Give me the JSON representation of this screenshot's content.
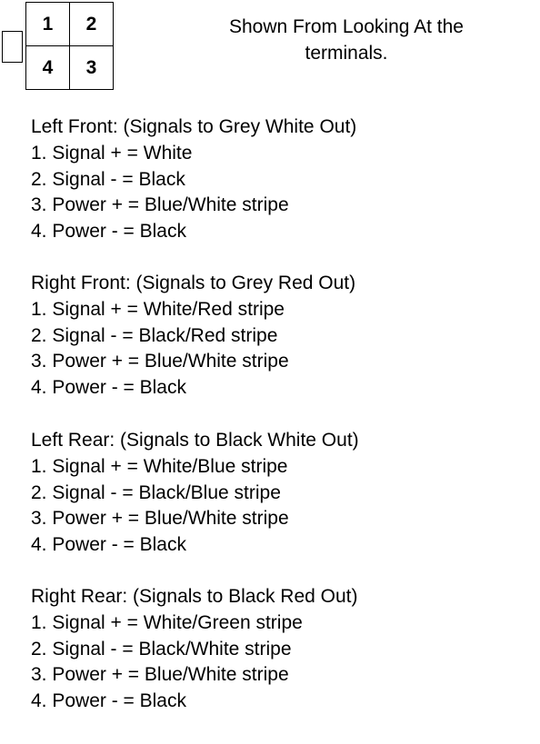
{
  "connector": {
    "pins": [
      {
        "position": "top-left",
        "label": "1"
      },
      {
        "position": "top-right",
        "label": "2"
      },
      {
        "position": "bottom-left",
        "label": "4"
      },
      {
        "position": "bottom-right",
        "label": "3"
      }
    ]
  },
  "caption": {
    "line1": "Shown From Looking At the",
    "line2": "terminals."
  },
  "sections": [
    {
      "title": "Left Front: (Signals to Grey White Out)",
      "lines": [
        "1. Signal + = White",
        "2. Signal - = Black",
        "3. Power + = Blue/White stripe",
        "4. Power - = Black"
      ]
    },
    {
      "title": "Right Front: (Signals to Grey Red Out)",
      "lines": [
        "1. Signal + = White/Red stripe",
        "2. Signal - = Black/Red stripe",
        "3. Power + = Blue/White stripe",
        "4. Power - = Black"
      ]
    },
    {
      "title": "Left Rear: (Signals to Black White Out)",
      "lines": [
        "1. Signal + = White/Blue stripe",
        "2. Signal - = Black/Blue stripe",
        "3. Power + = Blue/White stripe",
        "4. Power - = Black"
      ]
    },
    {
      "title": "Right Rear: (Signals to Black Red Out)",
      "lines": [
        "1. Signal + = White/Green stripe",
        "2. Signal - = Black/White stripe",
        "3. Power + = Blue/White stripe",
        "4. Power - = Black"
      ]
    }
  ]
}
